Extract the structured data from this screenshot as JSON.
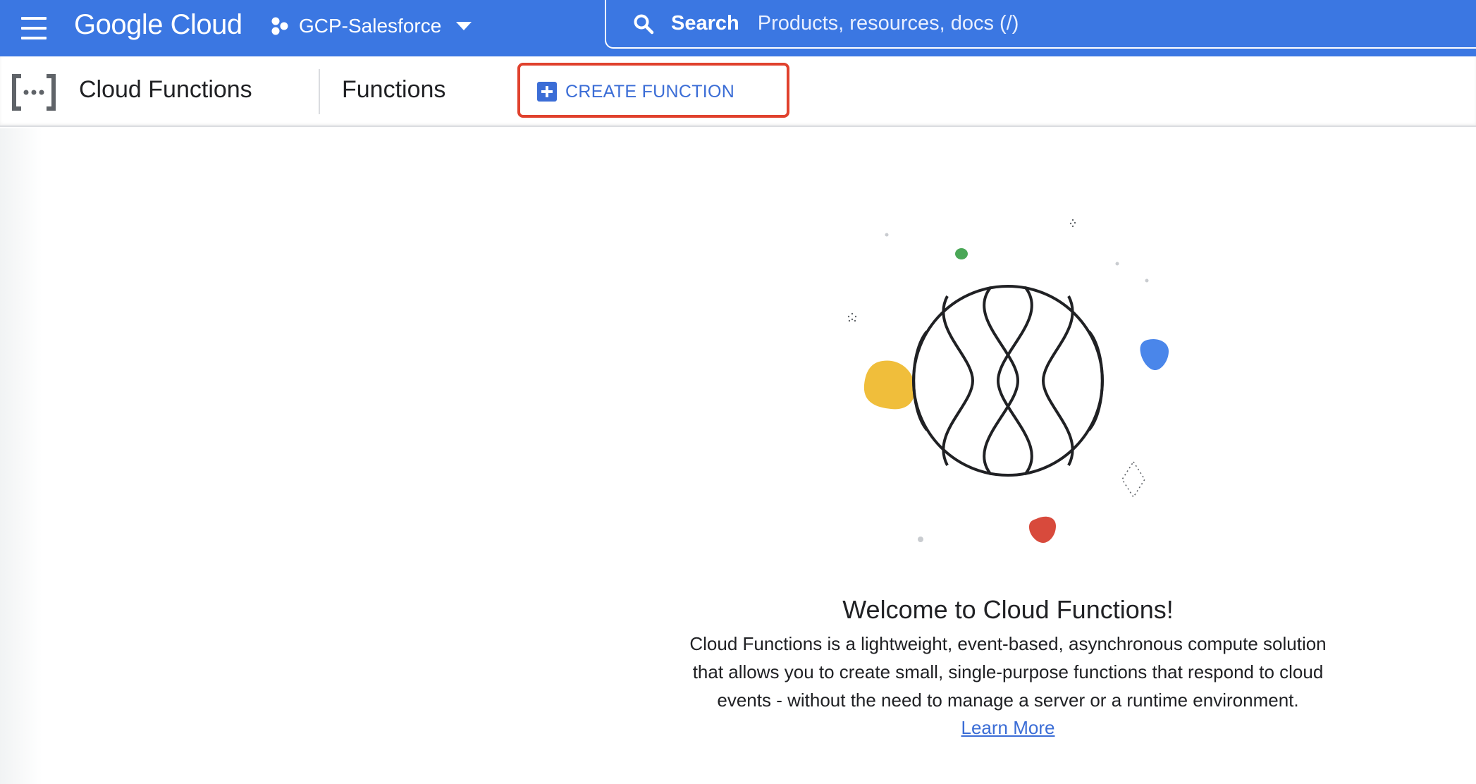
{
  "topbar": {
    "logo_text": "Google Cloud",
    "project_name": "GCP-Salesforce",
    "search_label": "Search",
    "search_placeholder": "Products, resources, docs (/)"
  },
  "subheader": {
    "product_title": "Cloud Functions",
    "page_title": "Functions",
    "create_button_label": "CREATE FUNCTION"
  },
  "empty_state": {
    "title": "Welcome to Cloud Functions!",
    "description_lines": [
      "Cloud Functions is a lightweight, event-based, asynchronous compute solution",
      "that allows you to create small, single-purpose functions that respond to cloud",
      "events - without the need to manage a server or a runtime environment."
    ],
    "learn_more_label": "Learn More"
  },
  "colors": {
    "topbar_bg": "#3b77e2",
    "accent_blue": "#3b6dd6",
    "highlight_red": "#e0412d",
    "blob_yellow": "#f0be3b",
    "blob_green": "#4aa757",
    "blob_blue": "#4a86ea",
    "blob_red": "#d84a3c"
  },
  "icons": {
    "menu": "hamburger-menu-icon",
    "project": "project-hexagons-icon",
    "dropdown": "caret-down-icon",
    "search": "search-icon",
    "product": "cloud-functions-icon",
    "create": "add-box-icon"
  }
}
